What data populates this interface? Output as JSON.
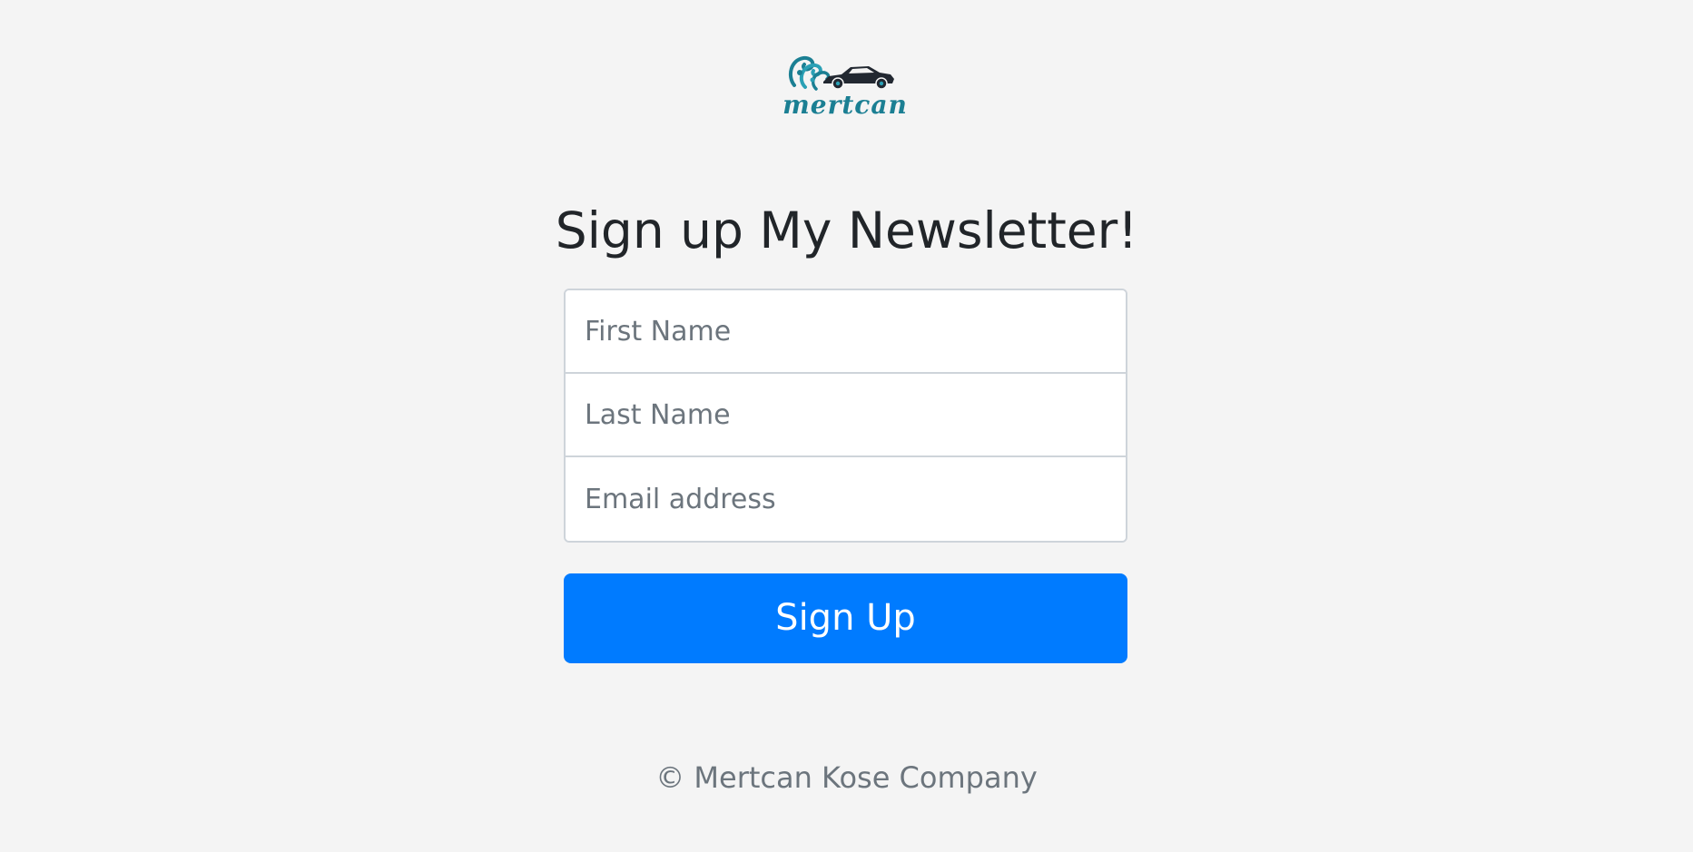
{
  "logo": {
    "text": "mertcan",
    "icon": "wave-car-icon",
    "color": "#1b7f93"
  },
  "main": {
    "title": "Sign up My Newsletter!"
  },
  "form": {
    "first_name_placeholder": "First Name",
    "last_name_placeholder": "Last Name",
    "email_placeholder": "Email address",
    "submit_label": "Sign Up",
    "submit_color": "#007bff"
  },
  "footer": {
    "copyright": "© Mertcan Kose Company"
  }
}
